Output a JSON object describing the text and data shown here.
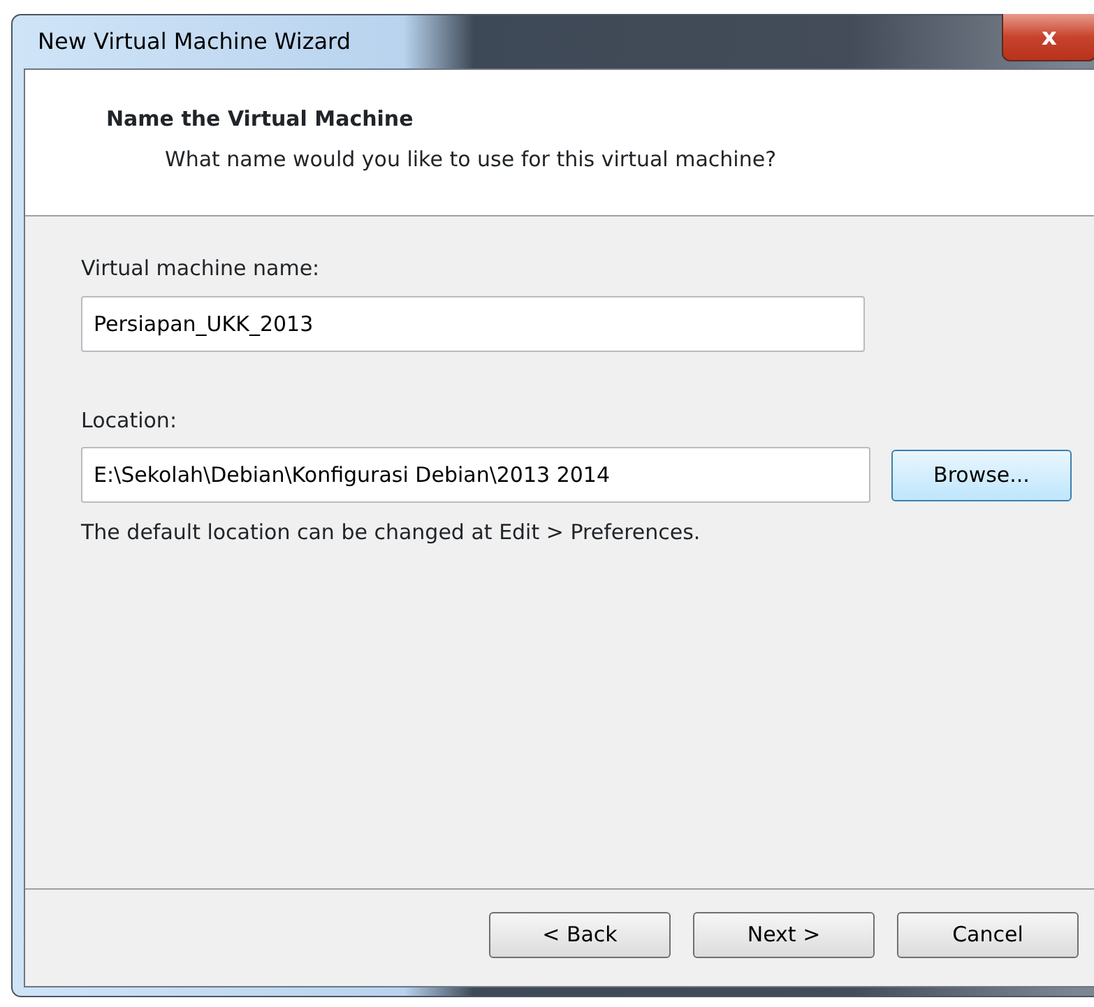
{
  "window": {
    "title": "New Virtual Machine Wizard",
    "close_label": "x"
  },
  "header": {
    "title": "Name the Virtual Machine",
    "subtitle": "What name would you like to use for this virtual machine?"
  },
  "fields": [
    {
      "label": "Virtual machine name:",
      "value": "Persiapan_UKK_2013"
    },
    {
      "label": "Location:",
      "value": "E:\\Sekolah\\Debian\\Konfigurasi Debian\\2013 2014",
      "button": "Browse...",
      "note": "The default location can be changed at Edit > Preferences."
    }
  ],
  "buttons": [
    {
      "label": "< Back"
    },
    {
      "label": "Next >"
    },
    {
      "label": "Cancel"
    }
  ]
}
